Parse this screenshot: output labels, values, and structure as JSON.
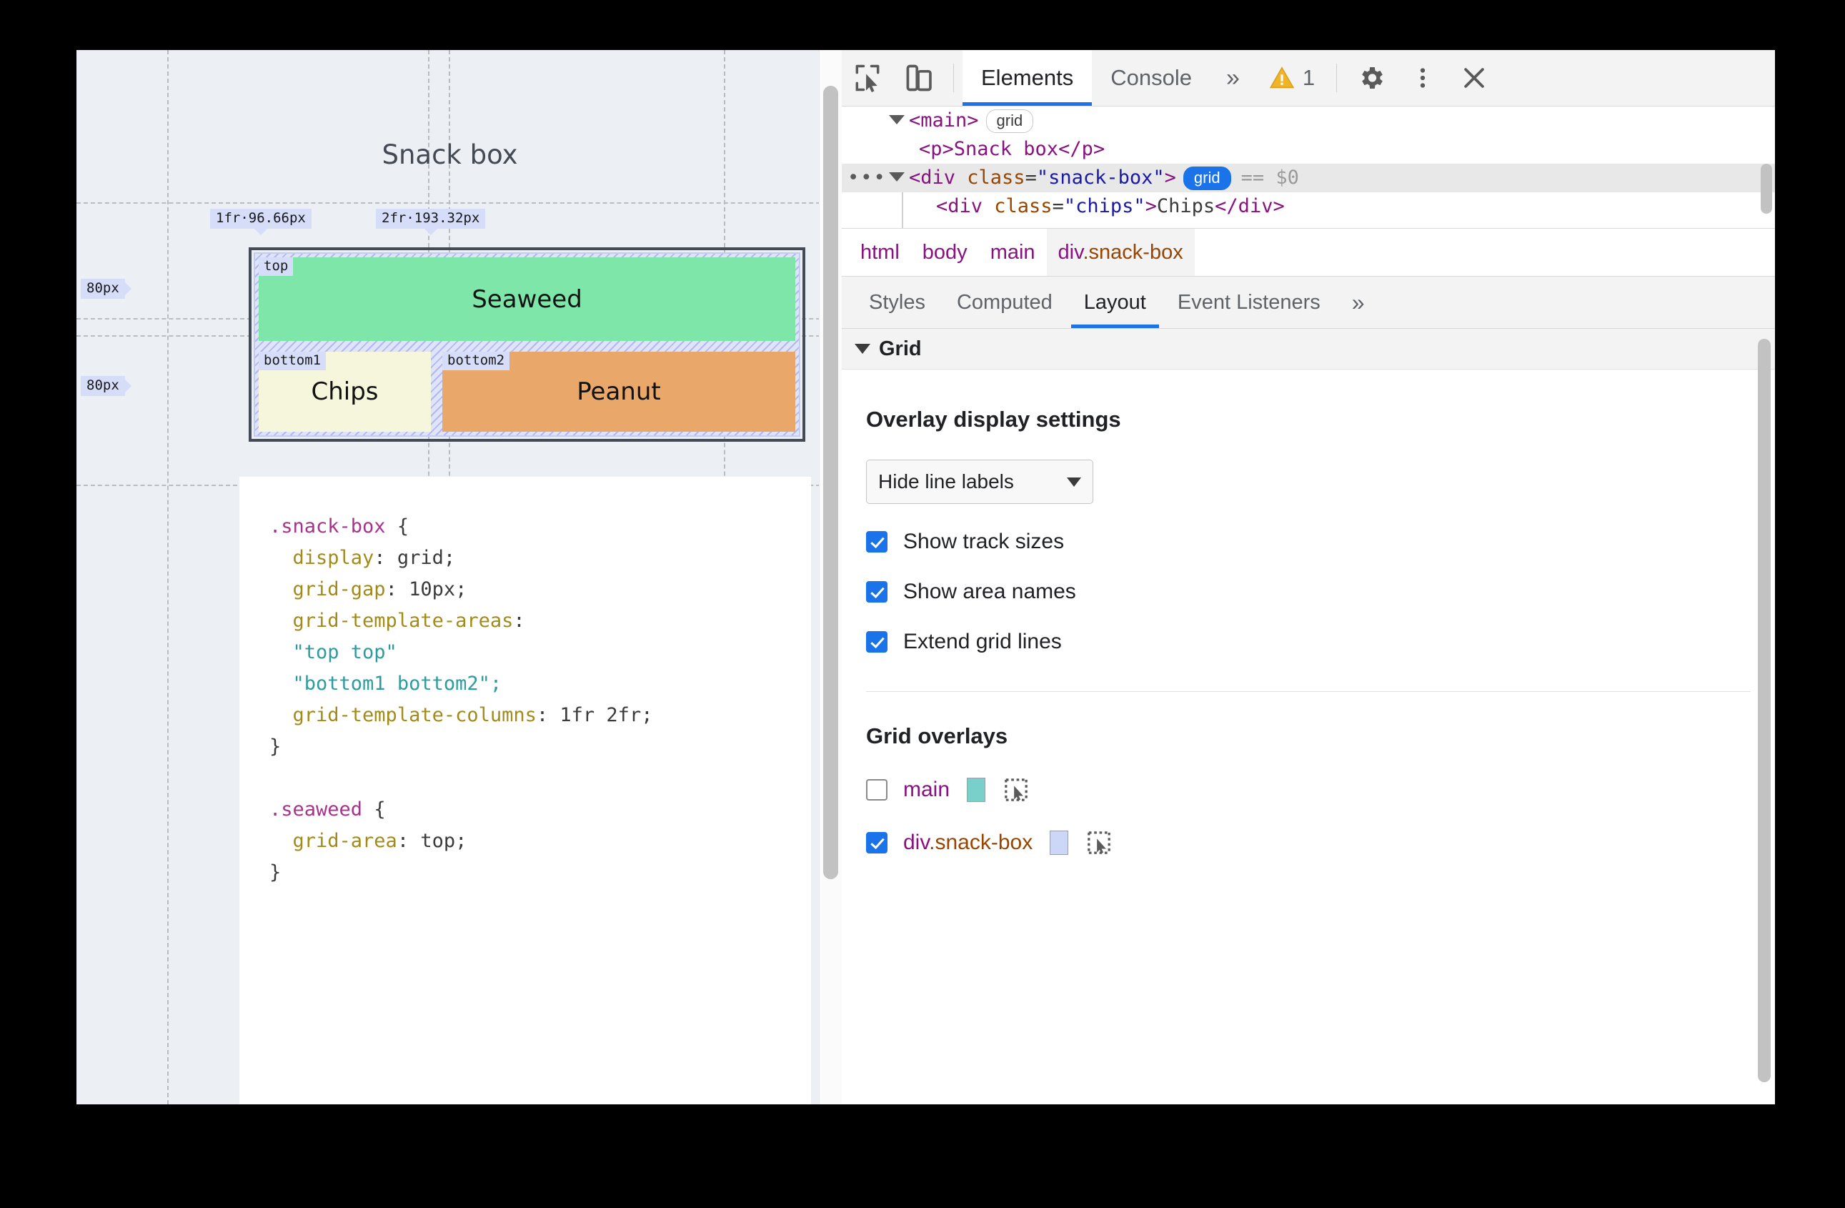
{
  "page": {
    "title": "Snack box",
    "grid": {
      "track_labels": [
        {
          "text": "1fr·96.66px"
        },
        {
          "text": "2fr·193.32px"
        }
      ],
      "row_labels": [
        {
          "text": "80px"
        },
        {
          "text": "80px"
        }
      ],
      "areas": [
        {
          "name": "top",
          "content": "Seaweed",
          "color": "#7fe6aa"
        },
        {
          "name": "bottom1",
          "content": "Chips",
          "color": "#f6f6dc"
        },
        {
          "name": "bottom2",
          "content": "Peanut",
          "color": "#e9a86a"
        }
      ]
    },
    "code": {
      "rule1_selector": ".snack-box",
      "rule1_open": "{",
      "lines": [
        {
          "prop": "display",
          "value": "grid;"
        },
        {
          "prop": "grid-gap",
          "value": "10px;"
        }
      ],
      "areas_prop": "grid-template-areas",
      "areas_line1": "\"top top\"",
      "areas_line2": "\"bottom1 bottom2\";",
      "cols_prop": "grid-template-columns",
      "cols_value": "1fr 2fr;",
      "close1": "}",
      "rule2_selector": ".seaweed",
      "rule2_open": "{",
      "rule2_prop": "grid-area",
      "rule2_value": "top;",
      "close2": "}"
    }
  },
  "devtools": {
    "toolbar": {
      "inspect_icon": "inspect-element-icon",
      "device_icon": "device-toolbar-icon",
      "tabs": [
        {
          "label": "Elements",
          "active": true
        },
        {
          "label": "Console",
          "active": false
        }
      ],
      "more_tabs": "»",
      "warning_count": "1",
      "settings_icon": "gear-icon",
      "menu_icon": "kebab-menu-icon",
      "close_icon": "close-icon"
    },
    "dom": {
      "row1": {
        "tag_open": "<main>",
        "badge": "grid"
      },
      "row2": {
        "text": "<p>Snack box</p>"
      },
      "row3": {
        "tag_start": "<div ",
        "attr": "class",
        "eq": "=",
        "value": "\"snack-box\"",
        "tag_end": ">",
        "badge": "grid",
        "eq_dollar": "== $0",
        "ellipsis": "•••"
      },
      "row4": {
        "tag_start": "<div ",
        "attr": "class",
        "eq": "=",
        "value": "\"chips\"",
        "gt": ">",
        "text": "Chips",
        "close": "</div>"
      }
    },
    "breadcrumb": [
      {
        "label": "html",
        "active": false
      },
      {
        "label": "body",
        "active": false
      },
      {
        "label": "main",
        "active": false
      },
      {
        "label": "div",
        "suffix": ".snack-box",
        "active": true
      }
    ],
    "subtabs": [
      {
        "label": "Styles",
        "active": false
      },
      {
        "label": "Computed",
        "active": false
      },
      {
        "label": "Layout",
        "active": true
      },
      {
        "label": "Event Listeners",
        "active": false
      }
    ],
    "subtabs_more": "»",
    "layout": {
      "section_title": "Grid",
      "overlay_settings_title": "Overlay display settings",
      "line_labels_select": "Hide line labels",
      "checkboxes": [
        {
          "label": "Show track sizes",
          "checked": true
        },
        {
          "label": "Show area names",
          "checked": true
        },
        {
          "label": "Extend grid lines",
          "checked": true
        }
      ],
      "overlays_title": "Grid overlays",
      "overlays": [
        {
          "name": "main",
          "suffix": "",
          "checked": false,
          "color": "#79cfc9"
        },
        {
          "name": "div",
          "suffix": ".snack-box",
          "checked": true,
          "color": "#ccd6f7"
        }
      ]
    }
  }
}
